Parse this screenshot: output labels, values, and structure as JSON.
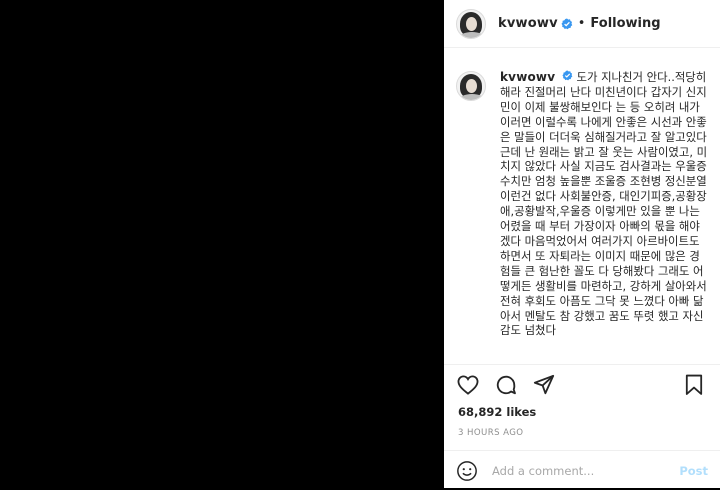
{
  "header": {
    "username": "kvwowv",
    "separator": "•",
    "follow_status": "Following"
  },
  "caption": {
    "username": "kvwowv",
    "text": "도가 지나친거 안다..적당히 해라 진절머리 난다 미친년이다 갑자기 신지민이 이제 불쌍해보인다 는 등 오히려 내가 이러면 이럴수록 나에게 안좋은 시선과 안좋은 말들이 더더욱 심해질거라고 잘 알고있다 근데 난 원래는 밝고 잘 웃는 사람이였고, 미치지 않았다 사실 지금도 검사결과는 우울증 수치만 엄청 높을뿐 조울증 조현병 정신분열 이런건 없다 사회불안증, 대인기피증,공황장애,공황발작,우울증 이렇게만 있을 뿐 나는 어렸을 때 부터 가장이자 아빠의 몫을 해야겠다 마음먹었어서 여러가지 아르바이트도 하면서 또 자퇴라는 이미지 때문에 많은 경험들 큰 험난한 꼴도 다 당해봤다 그래도 어떻게든 생활비를 마련하고, 강하게 살아와서 전혀 후회도 아픔도 그닥 못 느꼈다 아빠 닮아서 멘탈도 참 강했고 꿈도 뚜렷 했고 자신감도 넘쳤다"
  },
  "actions": {
    "likes": "68,892 likes",
    "time": "3 HOURS AGO"
  },
  "comment_box": {
    "placeholder": "Add a comment...",
    "post_label": "Post"
  },
  "colors": {
    "verified": "#3897f0",
    "post_button": "#b2dffc",
    "divider": "#efefef"
  },
  "icons": [
    "verified-badge-icon",
    "heart-icon",
    "comment-icon",
    "share-icon",
    "bookmark-icon",
    "emoji-icon"
  ]
}
